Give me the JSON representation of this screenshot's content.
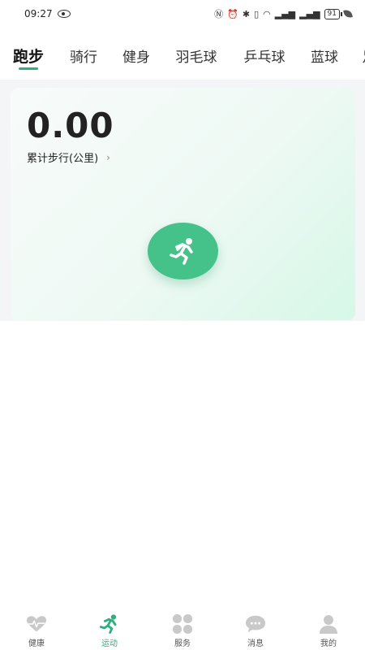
{
  "status_bar": {
    "time": "09:27",
    "battery": "91",
    "icons": [
      "eye-icon",
      "nfc-icon",
      "alarm-icon",
      "bluetooth-icon",
      "vibrate-icon",
      "wifi-icon",
      "signal-5g-icon",
      "signal-4g-icon",
      "battery-icon",
      "leaf-icon"
    ]
  },
  "tabs": [
    {
      "label": "跑步",
      "active": true
    },
    {
      "label": "骑行",
      "active": false
    },
    {
      "label": "健身",
      "active": false
    },
    {
      "label": "羽毛球",
      "active": false
    },
    {
      "label": "乒乓球",
      "active": false
    },
    {
      "label": "蓝球",
      "active": false
    },
    {
      "label": "足",
      "active": false
    }
  ],
  "run_card": {
    "distance": "0.00",
    "label": "累计步行(公里)",
    "chevron": "›",
    "start_icon": "running-person-icon"
  },
  "bottom_nav": [
    {
      "label": "健康",
      "icon": "heart-pulse-icon",
      "active": false
    },
    {
      "label": "运动",
      "icon": "running-person-icon",
      "active": true
    },
    {
      "label": "服务",
      "icon": "four-petal-icon",
      "active": false
    },
    {
      "label": "消息",
      "icon": "chat-bubble-icon",
      "active": false
    },
    {
      "label": "我的",
      "icon": "user-icon",
      "active": false
    }
  ],
  "colors": {
    "accent": "#2fae7e",
    "button": "#45c28a",
    "inactive_icon": "#c9c9c9"
  }
}
